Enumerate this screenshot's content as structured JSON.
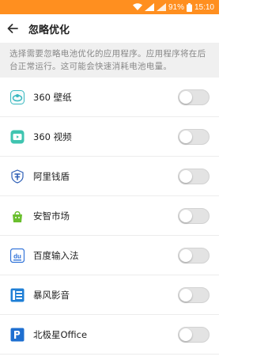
{
  "status_bar": {
    "battery_percent": "91%",
    "time": "15:10"
  },
  "header": {
    "title": "忽略优化"
  },
  "description": "选择需要忽略电池优化的应用程序。应用程序将在后台正常运行。这可能会快速消耗电池电量。",
  "apps": [
    {
      "name": "360 壁纸",
      "icon": "360-wallpaper-icon",
      "enabled": false
    },
    {
      "name": "360 视频",
      "icon": "360-video-icon",
      "enabled": false
    },
    {
      "name": "阿里钱盾",
      "icon": "ali-qiandun-icon",
      "enabled": false
    },
    {
      "name": "安智市场",
      "icon": "anzhi-market-icon",
      "enabled": false
    },
    {
      "name": "百度输入法",
      "icon": "baidu-input-icon",
      "enabled": false
    },
    {
      "name": "暴风影音",
      "icon": "baofeng-player-icon",
      "enabled": false
    },
    {
      "name": "北极星Office",
      "icon": "polaris-office-icon",
      "enabled": false
    }
  ],
  "colors": {
    "status_bar": "#ff8f1f",
    "toggle_off": "#e3e3e3"
  }
}
